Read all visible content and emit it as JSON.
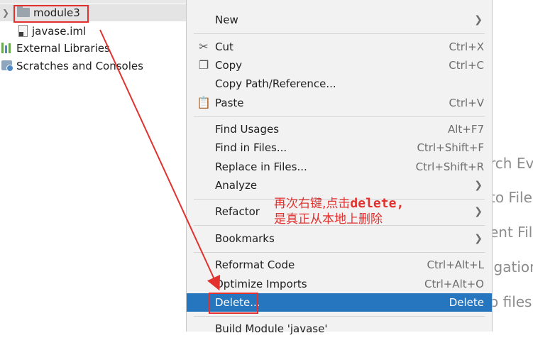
{
  "tree": {
    "items": [
      {
        "label": "module3",
        "icon": "folder-icon"
      },
      {
        "label": "javase.iml",
        "icon": "iml-file-icon"
      },
      {
        "label": "External Libraries",
        "icon": "library-icon"
      },
      {
        "label": "Scratches and Consoles",
        "icon": "scratches-icon"
      }
    ]
  },
  "background_hints": [
    "rch Eve",
    "to File",
    "ent File",
    "igation",
    "o files"
  ],
  "context_menu": {
    "items": [
      {
        "label": "New",
        "shortcut": "",
        "submenu": true
      },
      {
        "label": "Cut",
        "shortcut": "Ctrl+X",
        "icon": "scissors-icon"
      },
      {
        "label": "Copy",
        "shortcut": "Ctrl+C",
        "icon": "copy-icon"
      },
      {
        "label": "Copy Path/Reference...",
        "shortcut": ""
      },
      {
        "label": "Paste",
        "shortcut": "Ctrl+V",
        "icon": "paste-icon"
      },
      {
        "label": "Find Usages",
        "shortcut": "Alt+F7"
      },
      {
        "label": "Find in Files...",
        "shortcut": "Ctrl+Shift+F"
      },
      {
        "label": "Replace in Files...",
        "shortcut": "Ctrl+Shift+R"
      },
      {
        "label": "Analyze",
        "shortcut": "",
        "submenu": true
      },
      {
        "label": "Refactor",
        "shortcut": "",
        "submenu": true
      },
      {
        "label": "Bookmarks",
        "shortcut": "",
        "submenu": true
      },
      {
        "label": "Reformat Code",
        "shortcut": "Ctrl+Alt+L"
      },
      {
        "label": "Optimize Imports",
        "shortcut": "Ctrl+Alt+O"
      },
      {
        "label": "Delete...",
        "shortcut": "Delete",
        "selected": true
      },
      {
        "label": "Build Module 'javase'",
        "shortcut": ""
      }
    ],
    "selection_color": "#2675bf"
  },
  "annotation": {
    "line1_prefix": "再次右键,点击",
    "line1_code": "delete",
    "line1_suffix": ",",
    "line2": "是真正从本地上删除",
    "color": "#e2312f"
  }
}
